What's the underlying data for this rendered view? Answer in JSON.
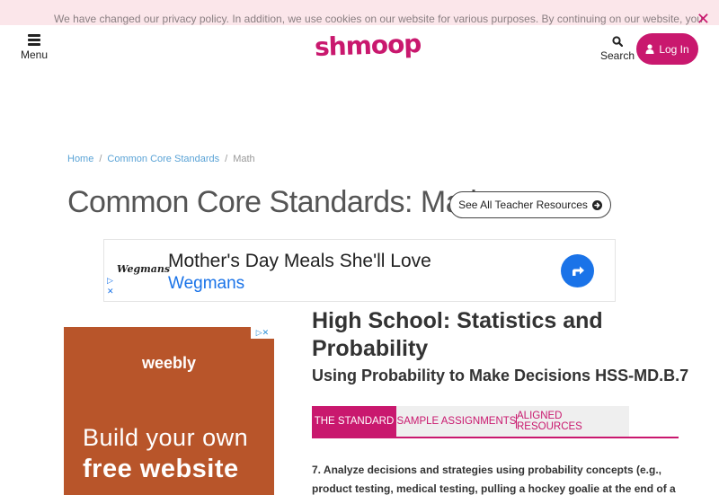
{
  "cookie_banner": {
    "text": "We have changed our privacy policy. In addition, we use cookies on our website for various purposes. By continuing on our website, you",
    "close": "✕"
  },
  "header": {
    "menu_label": "Menu",
    "logo": "shmoop",
    "search_label": "Search",
    "login_label": "Log In"
  },
  "breadcrumb": {
    "home": "Home",
    "ccs": "Common Core Standards",
    "current": "Math",
    "sep": "/"
  },
  "page": {
    "title": "Common Core Standards: Math",
    "teacher_button": "See All Teacher Resources"
  },
  "ad_banner": {
    "logo": "Wegmans",
    "headline": "Mother's Day Meals She'll Love",
    "brand": "Wegmans",
    "choice": "▷\n✕"
  },
  "side_ad": {
    "choice": "▷✕",
    "brand": "weebly",
    "line1": "Build your own",
    "line2": "free website"
  },
  "content": {
    "title": "High School: Statistics and Probability",
    "subtitle": "Using Probability to Make Decisions HSS-MD.B.7",
    "tabs": [
      {
        "label": "THE STANDARD"
      },
      {
        "label": "SAMPLE ASSIGNMENTS"
      },
      {
        "label": "ALIGNED RESOURCES"
      }
    ],
    "standard_text": "7. Analyze decisions and strategies using probability concepts (e.g., product testing, medical testing, pulling a hockey goalie at the end of a"
  },
  "colors": {
    "brand": "#c9186e",
    "link": "#1a73e8",
    "cookie_bg": "#fbe6ea",
    "ad_bg": "#b8552a"
  }
}
